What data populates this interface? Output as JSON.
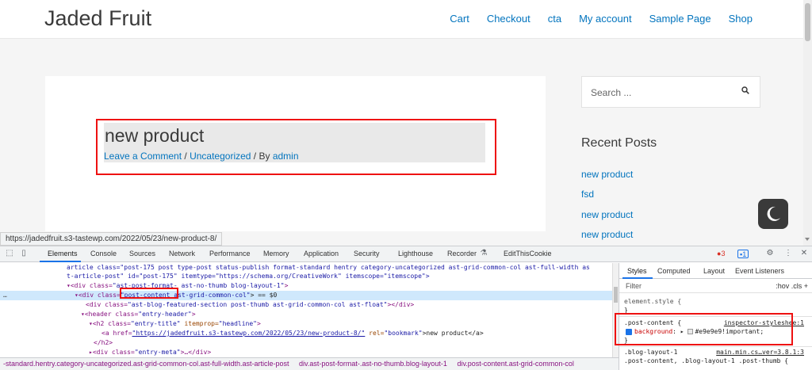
{
  "site": {
    "title": "Jaded Fruit",
    "nav": [
      "Cart",
      "Checkout",
      "cta",
      "My account",
      "Sample Page",
      "Shop"
    ]
  },
  "article": {
    "title": "new product",
    "meta_comment": "Leave a Comment",
    "meta_sep1": " / ",
    "meta_category": "Uncategorized",
    "meta_sep2": " / By ",
    "meta_author": "admin"
  },
  "sidebar": {
    "search_placeholder": "Search ...",
    "recent_title": "Recent Posts",
    "recent_posts": [
      "new product",
      "fsd",
      "new product",
      "new product"
    ]
  },
  "status_url": "https://jadedfruit.s3-tastewp.com/2022/05/23/new-product-8/",
  "devtools": {
    "tabs": [
      "Elements",
      "Console",
      "Sources",
      "Network",
      "Performance",
      "Memory",
      "Application",
      "Security",
      "Lighthouse",
      "Recorder",
      "EditThisCookie"
    ],
    "errors": "3",
    "messages": "1",
    "dom_lines": {
      "l0": "article class=\"post-175 post type-post status-publish format-standard hentry category-uncategorized ast-grid-common-col ast-full-width as",
      "l1": "t-article-post\" id=\"post-175\" itemtype=\"https://schema.org/CreativeWork\" itemscope=\"itemscope\">",
      "l2_tag": "<div class=",
      "l2_val": "\"ast-post-format- ast-no-thumb blog-layout-1\"",
      "l2_end": ">",
      "l3_tag": "<div class=",
      "l3_val1": "\"post-content",
      "l3_val2": " ast-grid-common-col\"",
      "l3_end": "> == $0",
      "l4_tag": "<div class=",
      "l4_val": "\"ast-blog-featured-section post-thumb ast-grid-common-col ast-float\"",
      "l4_end": "></div>",
      "l5_tag": "<header class=",
      "l5_val": "\"entry-header\"",
      "l5_end": ">",
      "l6_tag": "<h2 class=",
      "l6_val": "\"entry-title\"",
      "l6_attr": " itemprop=",
      "l6_val2": "\"headline\"",
      "l6_end": ">",
      "l7_tag": "<a href=",
      "l7_val": "\"https://jadedfruit.s3-tastewp.com/2022/05/23/new-product-8/\"",
      "l7_attr": " rel=",
      "l7_val2": "\"bookmark\"",
      "l7_text": ">new product</a>",
      "l8": "</h2>",
      "l9_tag": "<div class=",
      "l9_val": "\"entry-meta\"",
      "l9_end": ">…</div>"
    },
    "breadcrumbs": [
      "-standard.hentry.category-uncategorized.ast-grid-common-col.ast-full-width.ast-article-post",
      "div.ast-post-format-.ast-no-thumb.blog-layout-1",
      "div.post-content.ast-grid-common-col"
    ],
    "styles_tabs": [
      "Styles",
      "Computed",
      "Layout",
      "Event Listeners"
    ],
    "filter_placeholder": "Filter",
    "filter_tools": ":hov .cls +",
    "element_style": "element.style {",
    "close_brace": "}",
    "rule1_selector": ".post-content {",
    "rule1_source": "inspector-styleshee:1",
    "rule1_prop": "background",
    "rule1_value": "#e9e9e9!important;",
    "rule2_selector": ".blog-layout-1",
    "rule2_source": "main.min.cs…ver=3.8.1:3",
    "rule3_selector": ".post-content, .blog-layout-1 .post-thumb {"
  }
}
